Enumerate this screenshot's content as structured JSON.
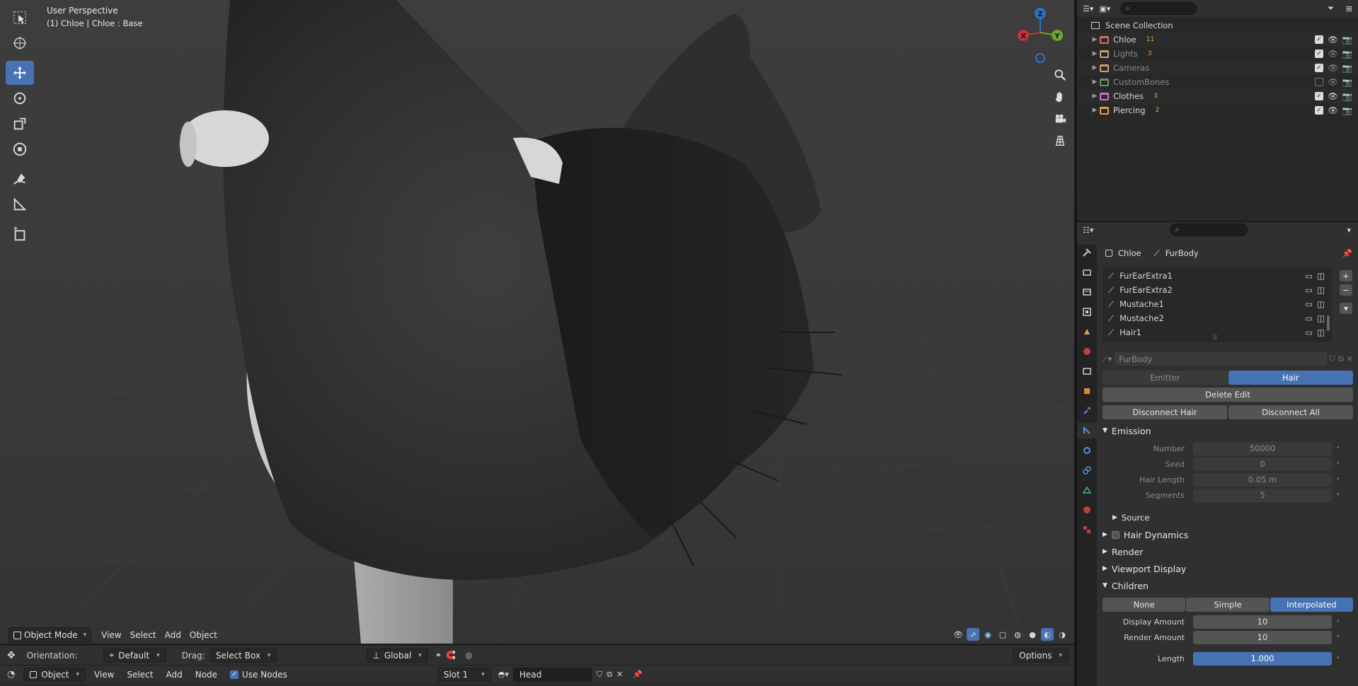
{
  "viewport": {
    "perspective": "User Perspective",
    "object_info": "(1) Chloe | Chloe : Base",
    "header": {
      "mode": "Object Mode",
      "menus": [
        "View",
        "Select",
        "Add",
        "Object"
      ]
    },
    "gizmo": {
      "z": "Z",
      "x": "X",
      "y": "Y"
    },
    "tools": [
      "select-box",
      "cursor",
      "move",
      "rotate",
      "scale",
      "transform",
      "annotate",
      "measure",
      "add-cube"
    ]
  },
  "tool_settings": {
    "orientation_label": "Orientation:",
    "orientation_value": "Default",
    "drag_label": "Drag:",
    "drag_value": "Select Box",
    "transform_orientation": "Global",
    "options": "Options"
  },
  "node_header": {
    "mode": "Object",
    "menus": [
      "View",
      "Select",
      "Add",
      "Node"
    ],
    "use_nodes": "Use Nodes",
    "slot": "Slot 1",
    "material": "Head"
  },
  "outliner": {
    "root": "Scene Collection",
    "collections": [
      {
        "name": "Chloe",
        "color": "#e06868",
        "badge": "11",
        "enabled": true,
        "dim": false
      },
      {
        "name": "Lights",
        "color": "#c8a070",
        "badge": "3",
        "enabled": true,
        "dim": true
      },
      {
        "name": "Cameras",
        "color": "#c8a070",
        "badge": "",
        "enabled": true,
        "dim": true
      },
      {
        "name": "CustomBones",
        "color": "#6c9060",
        "badge": "",
        "enabled": false,
        "dim": true
      },
      {
        "name": "Clothes",
        "color": "#d070d0",
        "badge": "3",
        "enabled": true,
        "dim": false
      },
      {
        "name": "Piercing",
        "color": "#e0a050",
        "badge": "2",
        "enabled": true,
        "dim": false
      }
    ]
  },
  "properties": {
    "breadcrumb_object": "Chloe",
    "breadcrumb_system": "FurBody",
    "particle_systems": [
      "FurEarExtra1",
      "FurEarExtra2",
      "Mustache1",
      "Mustache2",
      "Hair1"
    ],
    "settings_name": "FurBody",
    "type_options": [
      "Emitter",
      "Hair"
    ],
    "type_selected": "Hair",
    "delete_edit": "Delete Edit",
    "disconnect_hair": "Disconnect Hair",
    "disconnect_all": "Disconnect All",
    "emission": {
      "title": "Emission",
      "number_label": "Number",
      "number": "50000",
      "seed_label": "Seed",
      "seed": "0",
      "hair_length_label": "Hair Length",
      "hair_length": "0.05 m",
      "segments_label": "Segments",
      "segments": "5",
      "source": "Source"
    },
    "panels": [
      "Hair Dynamics",
      "Render",
      "Viewport Display"
    ],
    "children": {
      "title": "Children",
      "options": [
        "None",
        "Simple",
        "Interpolated"
      ],
      "selected": "Interpolated",
      "display_amount_label": "Display Amount",
      "display_amount": "10",
      "render_amount_label": "Render Amount",
      "render_amount": "10",
      "length_label": "Length",
      "length": "1.000"
    }
  }
}
